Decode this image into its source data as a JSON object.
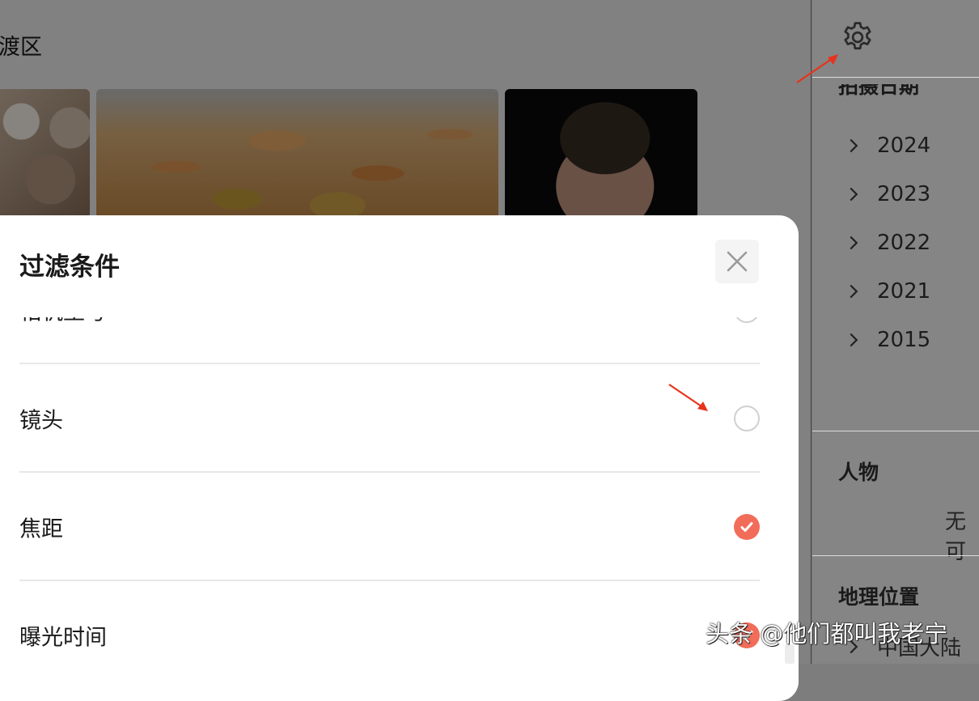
{
  "background": {
    "location_title": "渡区",
    "photos": [
      "seafood-platter",
      "grilled-shrimp",
      "portrait"
    ]
  },
  "sidebar": {
    "shoot_date_label": "拍摄日期",
    "years": [
      "2024",
      "2023",
      "2022",
      "2021",
      "2015"
    ],
    "people_title": "人物",
    "people_value": "无可",
    "geo_title": "地理位置",
    "geo_item": "中国大陆"
  },
  "modal": {
    "title": "过滤条件",
    "cut_row_label": "相机型号",
    "rows": [
      {
        "label": "镜头",
        "checked": false
      },
      {
        "label": "焦距",
        "checked": true
      },
      {
        "label": "曝光时间",
        "checked": true
      }
    ]
  },
  "watermark": "头条 @他们都叫我老宁",
  "colors": {
    "accent": "#f26c5a",
    "annotation": "#e8321c",
    "overlay": "rgba(0,0,0,0.47)"
  }
}
